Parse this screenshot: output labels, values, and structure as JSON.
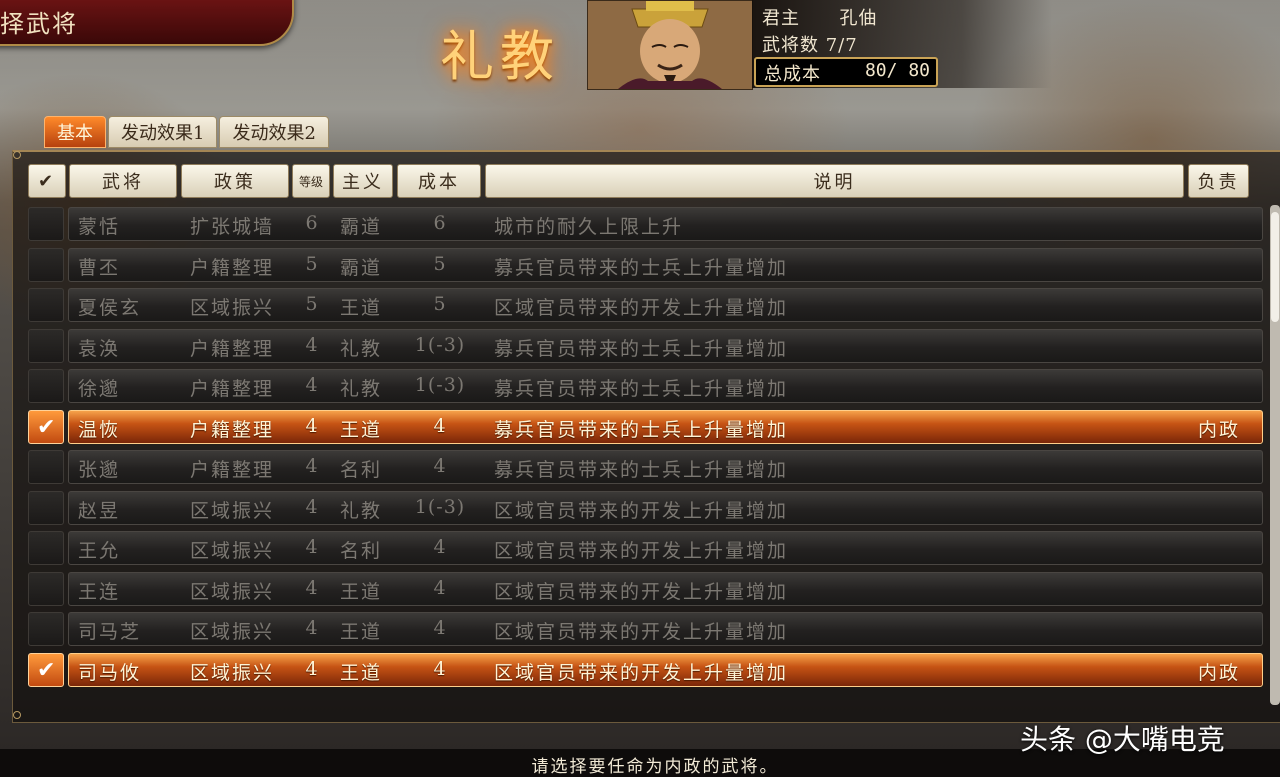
{
  "screen_title": "择武将",
  "policy_title": "礼教",
  "info": {
    "ruler_label": "君主",
    "ruler_name": "孔伷",
    "officer_count_label": "武将数",
    "officer_count": "7/7",
    "total_cost_label": "总成本",
    "total_cost": "80/ 80"
  },
  "tabs": [
    "基本",
    "发动效果1",
    "发动效果2"
  ],
  "headers": {
    "check": "✔",
    "officer": "武将",
    "policy": "政策",
    "level": "等级",
    "ideology": "主义",
    "cost": "成本",
    "description": "说明",
    "responsible": "负责"
  },
  "rows": [
    {
      "selected": false,
      "officer": "蒙恬",
      "policy": "扩张城墙",
      "level": "6",
      "ideology": "霸道",
      "cost": "6",
      "description": "城市的耐久上限上升",
      "responsible": ""
    },
    {
      "selected": false,
      "officer": "曹丕",
      "policy": "户籍整理",
      "level": "5",
      "ideology": "霸道",
      "cost": "5",
      "description": "募兵官员带来的士兵上升量增加",
      "responsible": ""
    },
    {
      "selected": false,
      "officer": "夏侯玄",
      "policy": "区域振兴",
      "level": "5",
      "ideology": "王道",
      "cost": "5",
      "description": "区域官员带来的开发上升量增加",
      "responsible": ""
    },
    {
      "selected": false,
      "officer": "袁涣",
      "policy": "户籍整理",
      "level": "4",
      "ideology": "礼教",
      "cost": "1(-3)",
      "description": "募兵官员带来的士兵上升量增加",
      "responsible": ""
    },
    {
      "selected": false,
      "officer": "徐邈",
      "policy": "户籍整理",
      "level": "4",
      "ideology": "礼教",
      "cost": "1(-3)",
      "description": "募兵官员带来的士兵上升量增加",
      "responsible": ""
    },
    {
      "selected": true,
      "officer": "温恢",
      "policy": "户籍整理",
      "level": "4",
      "ideology": "王道",
      "cost": "4",
      "description": "募兵官员带来的士兵上升量增加",
      "responsible": "内政"
    },
    {
      "selected": false,
      "officer": "张邈",
      "policy": "户籍整理",
      "level": "4",
      "ideology": "名利",
      "cost": "4",
      "description": "募兵官员带来的士兵上升量增加",
      "responsible": ""
    },
    {
      "selected": false,
      "officer": "赵昱",
      "policy": "区域振兴",
      "level": "4",
      "ideology": "礼教",
      "cost": "1(-3)",
      "description": "区域官员带来的开发上升量增加",
      "responsible": ""
    },
    {
      "selected": false,
      "officer": "王允",
      "policy": "区域振兴",
      "level": "4",
      "ideology": "名利",
      "cost": "4",
      "description": "区域官员带来的开发上升量增加",
      "responsible": ""
    },
    {
      "selected": false,
      "officer": "王连",
      "policy": "区域振兴",
      "level": "4",
      "ideology": "王道",
      "cost": "4",
      "description": "区域官员带来的开发上升量增加",
      "responsible": ""
    },
    {
      "selected": false,
      "officer": "司马芝",
      "policy": "区域振兴",
      "level": "4",
      "ideology": "王道",
      "cost": "4",
      "description": "区域官员带来的开发上升量增加",
      "responsible": ""
    },
    {
      "selected": true,
      "officer": "司马攸",
      "policy": "区域振兴",
      "level": "4",
      "ideology": "王道",
      "cost": "4",
      "description": "区域官员带来的开发上升量增加",
      "responsible": "内政"
    }
  ],
  "footer_hint": "请选择要任命为内政的武将。",
  "watermark": "头条 @大嘴电竞"
}
